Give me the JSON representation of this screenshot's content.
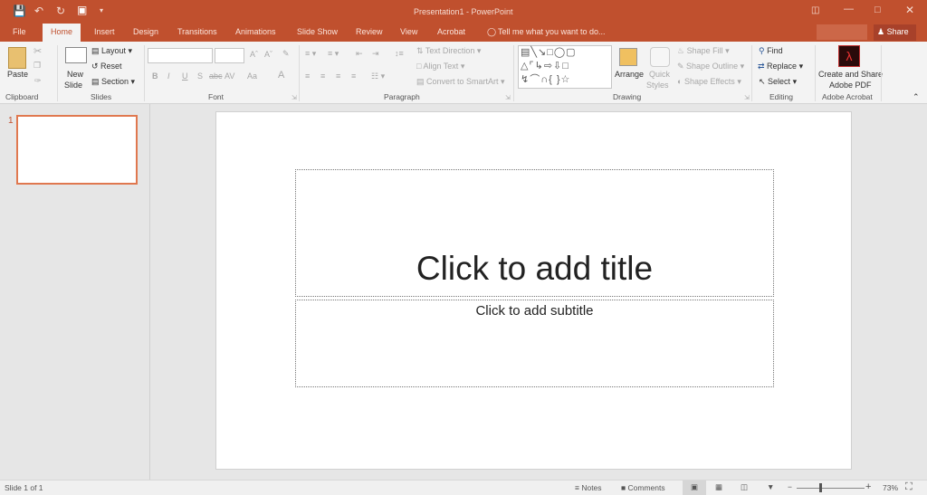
{
  "titlebar": {
    "title": "Presentation1 - PowerPoint",
    "qat": [
      "save-icon",
      "undo-icon",
      "redo-icon",
      "start-slideshow-icon",
      "customize-qat-icon"
    ]
  },
  "tabs": [
    {
      "label": "File"
    },
    {
      "label": "Home",
      "active": true
    },
    {
      "label": "Insert"
    },
    {
      "label": "Design"
    },
    {
      "label": "Transitions"
    },
    {
      "label": "Animations"
    },
    {
      "label": "Slide Show"
    },
    {
      "label": "Review"
    },
    {
      "label": "View"
    },
    {
      "label": "Acrobat"
    }
  ],
  "tell_me": "Tell me what you want to do...",
  "share": "Share",
  "ribbon": {
    "clipboard": {
      "label": "Clipboard",
      "paste": "Paste"
    },
    "slides": {
      "label": "Slides",
      "new_slide": "New",
      "new_slide2": "Slide",
      "layout": "Layout",
      "reset": "Reset",
      "section": "Section"
    },
    "font": {
      "label": "Font",
      "font_name": "",
      "font_size": "",
      "bold": "B",
      "italic": "I",
      "underline": "U",
      "strike": "S",
      "abc": "abc",
      "spacing": "AV",
      "case": "Aa",
      "color": "A"
    },
    "paragraph": {
      "label": "Paragraph",
      "text_direction": "Text Direction",
      "align_text": "Align Text",
      "convert": "Convert to SmartArt"
    },
    "drawing": {
      "label": "Drawing",
      "arrange": "Arrange",
      "quick": "Quick",
      "styles": "Styles",
      "shape_fill": "Shape Fill",
      "shape_outline": "Shape Outline",
      "shape_effects": "Shape Effects"
    },
    "editing": {
      "label": "Editing",
      "find": "Find",
      "replace": "Replace",
      "select": "Select"
    },
    "acrobat": {
      "label": "Adobe Acrobat",
      "create1": "Create and Share",
      "create2": "Adobe PDF"
    }
  },
  "thumbs": [
    {
      "number": "1"
    }
  ],
  "slide": {
    "title_placeholder": "Click to add title",
    "subtitle_placeholder": "Click to add subtitle"
  },
  "status": {
    "slide_count": "Slide 1 of 1",
    "notes": "Notes",
    "comments": "Comments",
    "zoom": "73%",
    "zoom_percent": 73
  },
  "colors": {
    "accent": "#c0502e"
  }
}
